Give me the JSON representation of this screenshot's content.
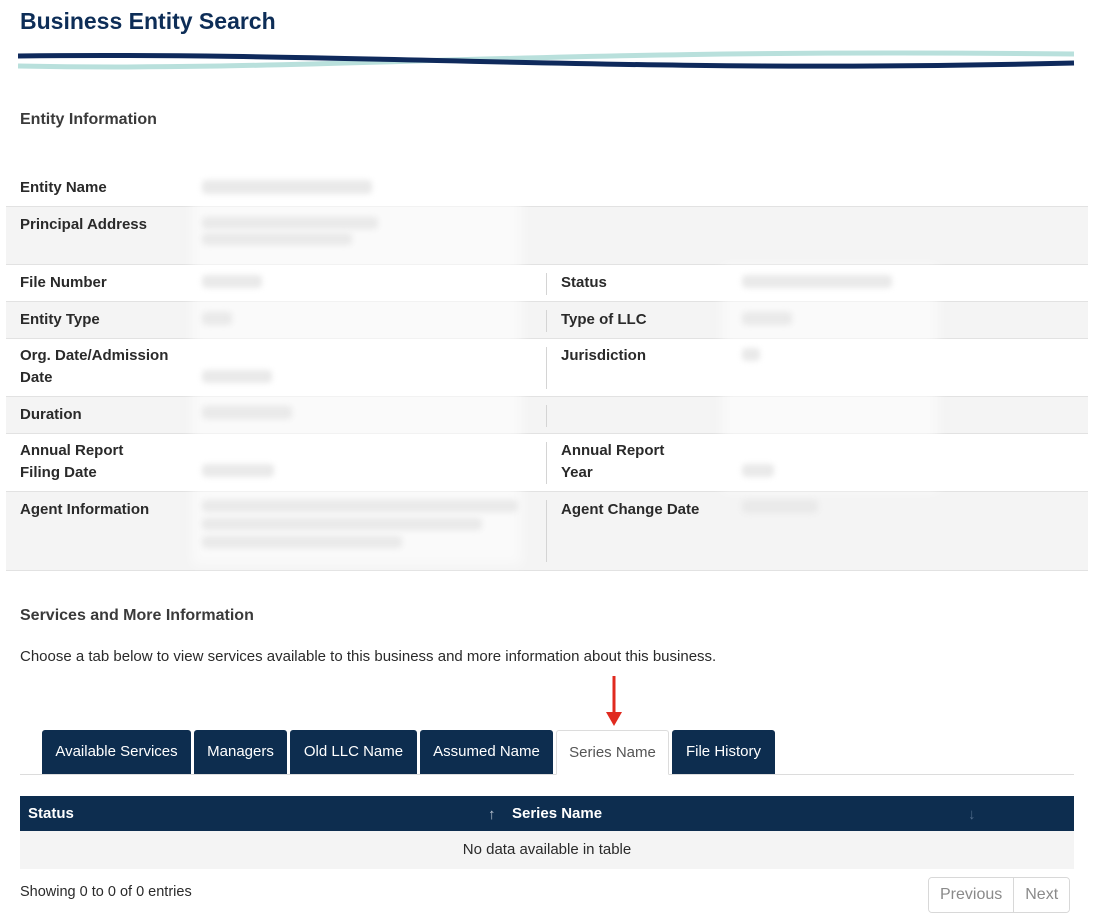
{
  "page_title": "Business Entity Search",
  "sections": {
    "entity_info_heading": "Entity Information",
    "services_heading": "Services and More Information",
    "services_description": "Choose a tab below to view services available to this business and more information about this business."
  },
  "fields": {
    "entity_name": "Entity Name",
    "principal_address": "Principal Address",
    "file_number": "File Number",
    "status": "Status",
    "entity_type": "Entity Type",
    "type_of_llc": "Type of LLC",
    "org_date_line1": "Org. Date/Admission",
    "org_date_line2": "Date",
    "jurisdiction": "Jurisdiction",
    "duration": "Duration",
    "annual_filing_line1": "Annual Report",
    "annual_filing_line2": "Filing Date",
    "annual_year_line1": "Annual Report",
    "annual_year_line2": "Year",
    "agent_information": "Agent Information",
    "agent_change_date": "Agent Change Date"
  },
  "tabs": [
    {
      "label": "Available Services",
      "active": false
    },
    {
      "label": "Managers",
      "active": false
    },
    {
      "label": "Old LLC Name",
      "active": false
    },
    {
      "label": "Assumed Name",
      "active": false
    },
    {
      "label": "Series Name",
      "active": true
    },
    {
      "label": "File History",
      "active": false
    }
  ],
  "table": {
    "columns": [
      "Status",
      "Series Name"
    ],
    "sort_up": "↑",
    "sort_down": "↓",
    "empty_message": "No data available in table"
  },
  "footer": {
    "showing": "Showing 0 to 0 of 0 entries",
    "previous": "Previous",
    "next": "Next"
  },
  "colors": {
    "brand_navy": "#0d2d4f",
    "title_blue": "#0d2d57",
    "wave_teal": "#b9e0dc",
    "arrow_red": "#e02a1f"
  }
}
